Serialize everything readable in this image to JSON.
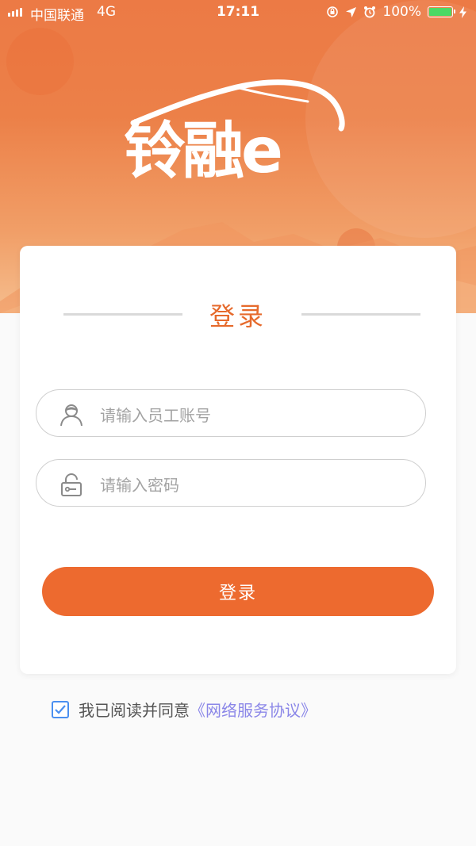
{
  "status_bar": {
    "carrier": "中国联通",
    "network": "4G",
    "time": "17:11",
    "battery_percent": "100%",
    "battery_level": 1.0,
    "icons": [
      "orientation-lock-icon",
      "location-arrow-icon",
      "alarm-icon",
      "battery-icon",
      "charging-bolt-icon"
    ]
  },
  "logo": {
    "text": "铃融e"
  },
  "login_card": {
    "title": "登录",
    "username": {
      "placeholder": "请输入员工账号",
      "icon": "user-icon"
    },
    "password": {
      "placeholder": "请输入密码",
      "icon": "lock-icon"
    },
    "submit_label": "登录"
  },
  "agreement": {
    "checked": true,
    "text": "我已阅读并同意",
    "link": "《网络服务协议》"
  },
  "colors": {
    "brand_orange": "#ed6a2f",
    "title_orange": "#e66a2c",
    "link_purple": "#8b87e8",
    "checkbox_blue": "#4a8ff0"
  }
}
